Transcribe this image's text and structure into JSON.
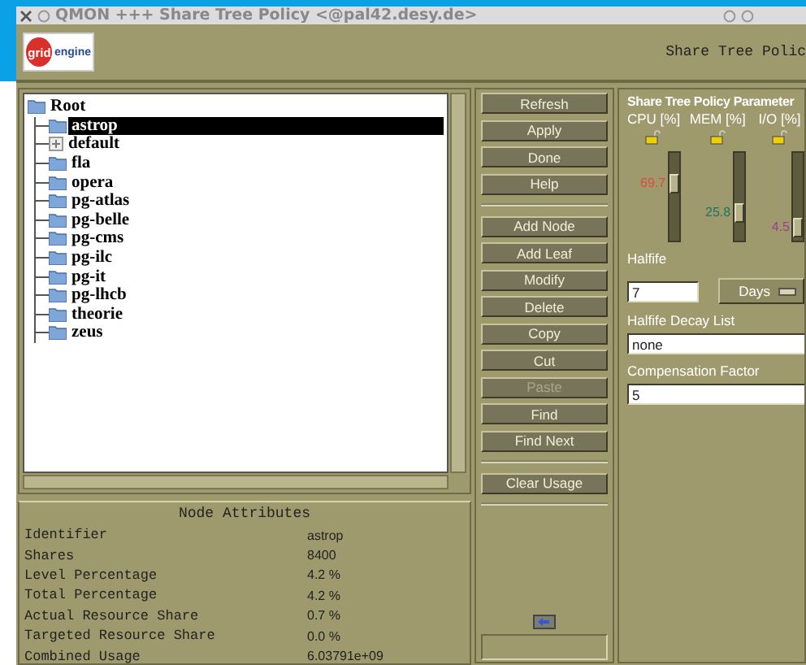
{
  "window": {
    "title": "QMON +++ Share Tree Policy <@pal42.desy.de>"
  },
  "header": {
    "logo": {
      "mark": "grid",
      "word": "engine"
    },
    "title": "Share Tree Polic"
  },
  "tree": {
    "label": "Root",
    "children": [
      {
        "label": "astrop",
        "selected": true,
        "collapsed": false
      },
      {
        "label": "default",
        "selected": false,
        "collapsed": true
      },
      {
        "label": "fla",
        "selected": false,
        "collapsed": false
      },
      {
        "label": "opera",
        "selected": false,
        "collapsed": false
      },
      {
        "label": "pg-atlas",
        "selected": false,
        "collapsed": false
      },
      {
        "label": "pg-belle",
        "selected": false,
        "collapsed": false
      },
      {
        "label": "pg-cms",
        "selected": false,
        "collapsed": false
      },
      {
        "label": "pg-ilc",
        "selected": false,
        "collapsed": false
      },
      {
        "label": "pg-it",
        "selected": false,
        "collapsed": false
      },
      {
        "label": "pg-lhcb",
        "selected": false,
        "collapsed": false
      },
      {
        "label": "theorie",
        "selected": false,
        "collapsed": false
      },
      {
        "label": "zeus",
        "selected": false,
        "collapsed": false
      }
    ]
  },
  "node_attributes": {
    "title": "Node Attributes",
    "rows": [
      {
        "name": "Identifier",
        "value": "astrop"
      },
      {
        "name": "Shares",
        "value": "8400"
      },
      {
        "name": "Level Percentage",
        "value": "4.2 %"
      },
      {
        "name": "Total Percentage",
        "value": "4.2 %"
      },
      {
        "name": "Actual Resource Share",
        "value": "0.7 %"
      },
      {
        "name": "Targeted Resource Share",
        "value": "0.0 %"
      },
      {
        "name": "Combined Usage",
        "value": "6.03791e+09"
      }
    ]
  },
  "button_groups": [
    [
      {
        "label": "Refresh",
        "disabled": false
      },
      {
        "label": "Apply",
        "disabled": false
      },
      {
        "label": "Done",
        "disabled": false
      },
      {
        "label": "Help",
        "disabled": false
      }
    ],
    [
      {
        "label": "Add Node",
        "disabled": false
      },
      {
        "label": "Add Leaf",
        "disabled": false
      },
      {
        "label": "Modify",
        "disabled": false
      },
      {
        "label": "Delete",
        "disabled": false
      },
      {
        "label": "Copy",
        "disabled": false
      },
      {
        "label": "Cut",
        "disabled": false
      },
      {
        "label": "Paste",
        "disabled": true
      },
      {
        "label": "Find",
        "disabled": false
      },
      {
        "label": "Find Next",
        "disabled": false
      }
    ],
    [
      {
        "label": "Clear Usage",
        "disabled": false
      }
    ]
  ],
  "parameters": {
    "title": "Share Tree Policy Parameter",
    "sliders": [
      {
        "label": "CPU [%]",
        "reading": "69.7",
        "level": 0.697,
        "color": "#e04a3a"
      },
      {
        "label": "MEM [%]",
        "reading": "25.8",
        "level": 0.258,
        "color": "#1d7560"
      },
      {
        "label": "I/O [%]",
        "reading": "4.5",
        "level": 0.045,
        "color": "#a03a90"
      }
    ],
    "halflife": {
      "label": "Halfife",
      "value": "7",
      "unit": "Days"
    },
    "decay_list": {
      "label": "Halfife Decay List",
      "value": "none"
    },
    "compensation": {
      "label": "Compensation Factor",
      "value": "5"
    }
  }
}
